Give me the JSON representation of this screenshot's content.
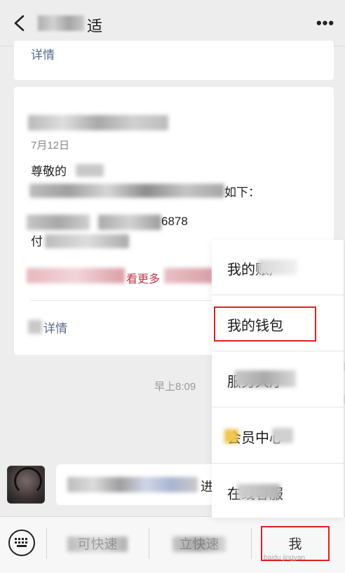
{
  "nav": {
    "title_suffix": "适",
    "more": "•••"
  },
  "messages": {
    "card1_link": "详情",
    "card2": {
      "date": "7月12日",
      "line1": "尊敬的",
      "line2": "如下：",
      "line3": "6878",
      "line4": "付",
      "red_text": "看更多",
      "link": "详情"
    },
    "time": "早上8:09",
    "bubble_suffix": "进"
  },
  "popup_menu": {
    "items": [
      {
        "label": "我的账户"
      },
      {
        "label": "我的钱包"
      },
      {
        "label": "服务大厅"
      },
      {
        "label": "会员中心"
      },
      {
        "label": "在线客服"
      }
    ]
  },
  "toolbar": {
    "btn1": "可快速",
    "btn2": "立快速",
    "me": "我"
  },
  "watermark": "baidu jingyan",
  "colors": {
    "highlight": "#e02020",
    "link": "#5b6b8c",
    "alert": "#c0394a"
  }
}
